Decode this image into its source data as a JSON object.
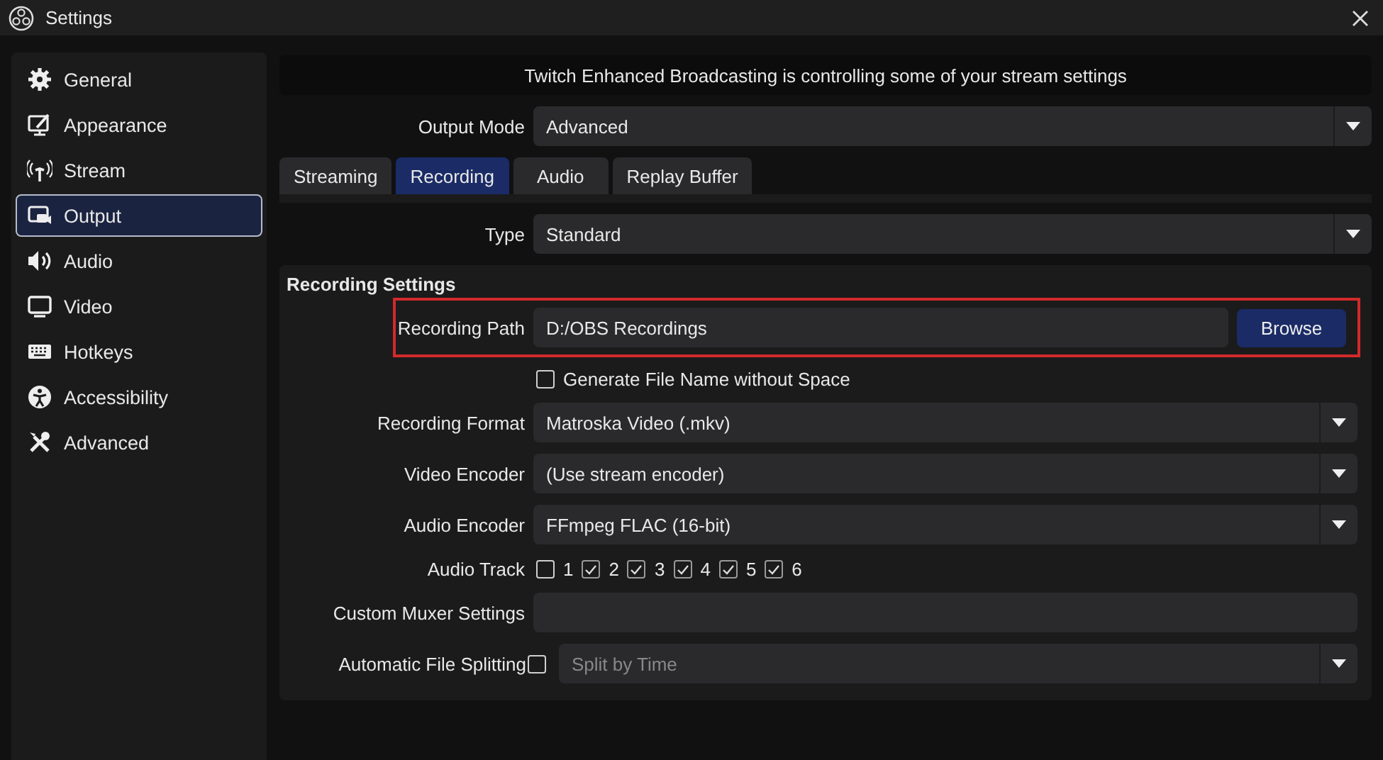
{
  "window": {
    "title": "Settings"
  },
  "sidebar": {
    "items": [
      {
        "label": "General",
        "selected": false
      },
      {
        "label": "Appearance",
        "selected": false
      },
      {
        "label": "Stream",
        "selected": false
      },
      {
        "label": "Output",
        "selected": true
      },
      {
        "label": "Audio",
        "selected": false
      },
      {
        "label": "Video",
        "selected": false
      },
      {
        "label": "Hotkeys",
        "selected": false
      },
      {
        "label": "Accessibility",
        "selected": false
      },
      {
        "label": "Advanced",
        "selected": false
      }
    ]
  },
  "banner": "Twitch Enhanced Broadcasting is controlling some of your stream settings",
  "output_mode": {
    "label": "Output Mode",
    "value": "Advanced"
  },
  "tabs": [
    {
      "label": "Streaming",
      "selected": false
    },
    {
      "label": "Recording",
      "selected": true
    },
    {
      "label": "Audio",
      "selected": false
    },
    {
      "label": "Replay Buffer",
      "selected": false
    }
  ],
  "type": {
    "label": "Type",
    "value": "Standard"
  },
  "group": {
    "title": "Recording Settings",
    "rows": [
      {
        "kind": "path",
        "label": "Recording Path",
        "value": "D:/OBS Recordings",
        "button": "Browse",
        "highlighted": true
      },
      {
        "kind": "checkbox",
        "label": "Generate File Name without Space",
        "checked": false
      },
      {
        "kind": "select",
        "label": "Recording Format",
        "value": "Matroska Video (.mkv)"
      },
      {
        "kind": "select",
        "label": "Video Encoder",
        "value": "(Use stream encoder)"
      },
      {
        "kind": "select",
        "label": "Audio Encoder",
        "value": "FFmpeg FLAC (16-bit)"
      },
      {
        "kind": "tracks",
        "label": "Audio Track",
        "tracks": [
          {
            "label": "1",
            "checked": false
          },
          {
            "label": "2",
            "checked": true
          },
          {
            "label": "3",
            "checked": true
          },
          {
            "label": "4",
            "checked": true
          },
          {
            "label": "5",
            "checked": true
          },
          {
            "label": "6",
            "checked": true
          }
        ]
      },
      {
        "kind": "text",
        "label": "Custom Muxer Settings"
      },
      {
        "kind": "split",
        "label": "Automatic File Splitting",
        "checked": false,
        "value": "Split by Time",
        "disabled": true
      }
    ]
  }
}
